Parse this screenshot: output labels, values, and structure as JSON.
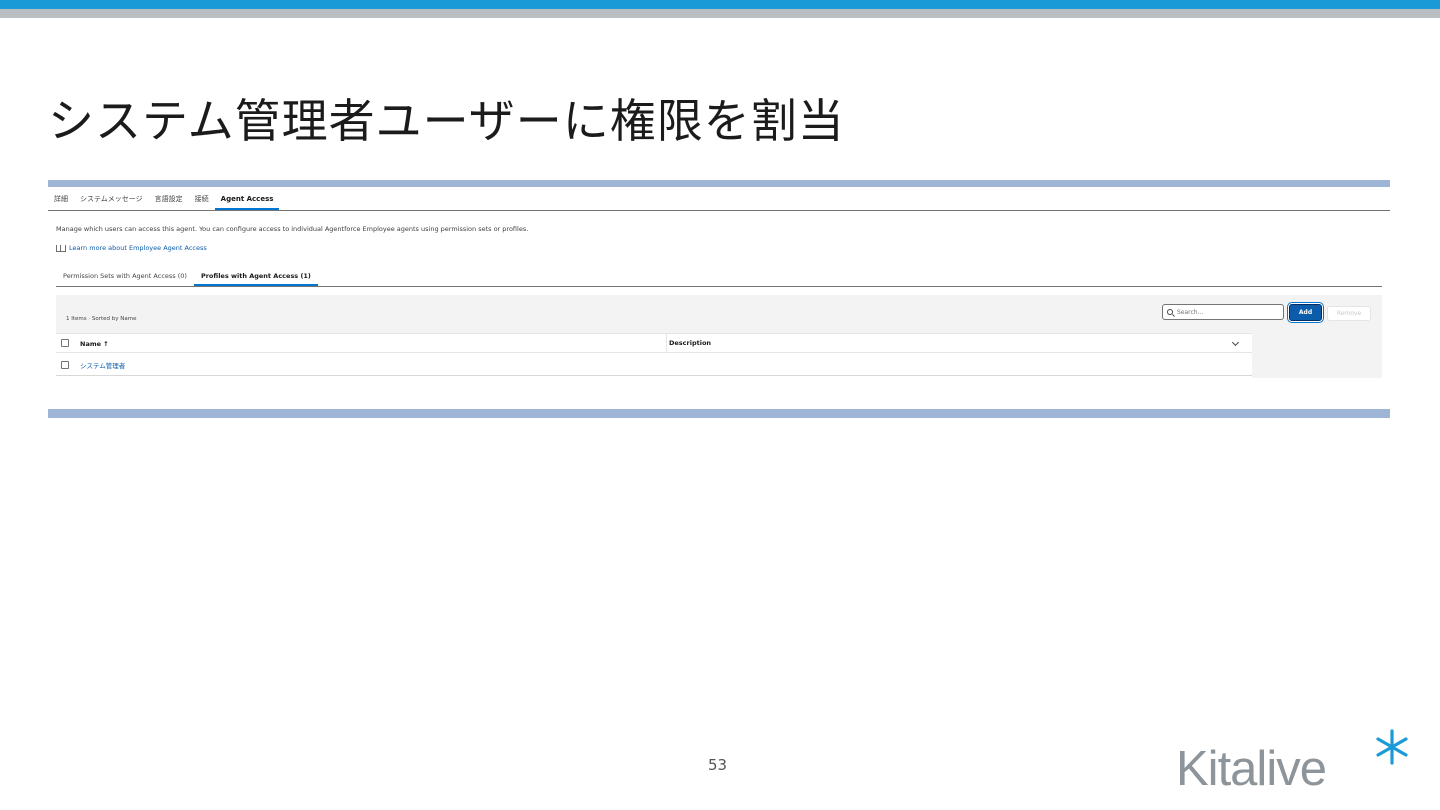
{
  "slide": {
    "title": "システム管理者ユーザーに権限を割当",
    "page_number": "53",
    "logo_text": "Kitalive",
    "accent_color": "#1a9ad6",
    "secondary_color": "#b9bec3",
    "logo_color": "#8d959b"
  },
  "agent_tabs": [
    "詳細",
    "システムメッセージ",
    "言語設定",
    "接続",
    "Agent Access"
  ],
  "agent_tabs_active": "Agent Access",
  "access": {
    "description": "Manage which users can access this agent. You can configure access to individual Agentforce Employee agents using permission sets or profiles.",
    "learn_more": "Learn more about Employee Agent Access",
    "sub_tabs": [
      "Permission Sets with Agent Access (0)",
      "Profiles with Agent Access (1)"
    ],
    "sub_tabs_active": "Profiles with Agent Access (1)",
    "list_meta": "1 Items · Sorted by Name",
    "search_placeholder": "Search...",
    "add_label": "Add",
    "remove_label": "Remove",
    "columns": {
      "name": "Name ↑",
      "description": "Description"
    },
    "rows": [
      {
        "name": "システム管理者",
        "description": ""
      }
    ]
  },
  "icons": [
    "book-icon",
    "search-icon",
    "chevron-down-icon",
    "sparkle-icon"
  ]
}
